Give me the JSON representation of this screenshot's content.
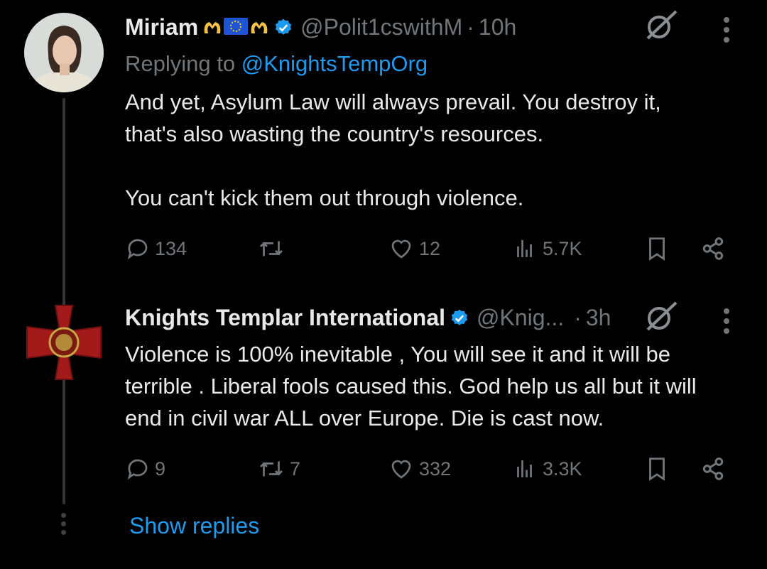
{
  "tweet1": {
    "name": "Miriam",
    "handle": "@Polit1cswithM",
    "separator": "·",
    "time": "10h",
    "replying_prefix": "Replying to",
    "replying_handle": "@KnightsTempOrg",
    "text_line1": "And yet, Asylum Law will always prevail. You destroy it,",
    "text_line2": "that's also wasting the country's resources.",
    "text_line3": "You can't kick them out through violence.",
    "replies": "134",
    "retweets": "",
    "likes": "12",
    "views": "5.7K"
  },
  "tweet2": {
    "name": "Knights Templar International",
    "handle": "@Knig...",
    "separator": "·",
    "time": "3h",
    "text_line1": "Violence is 100% inevitable , You will see it and it will be",
    "text_line2": "terrible . Liberal fools caused this. God help us all but it will",
    "text_line3": "end in civil war ALL over Europe. Die is cast now.",
    "replies": "9",
    "retweets": "7",
    "likes": "332",
    "views": "3.3K"
  },
  "show_replies": "Show replies",
  "colors": {
    "background": "#000000",
    "text": "#e7e9ea",
    "muted": "#71767b",
    "link": "#1d9bf0",
    "verified": "#1d9bf0"
  },
  "icons": [
    "grok-icon",
    "more-icon",
    "reply-icon",
    "retweet-icon",
    "like-icon",
    "views-icon",
    "bookmark-icon",
    "share-icon",
    "verified-icon",
    "emoji-hands-heart",
    "emoji-eu-flag"
  ]
}
